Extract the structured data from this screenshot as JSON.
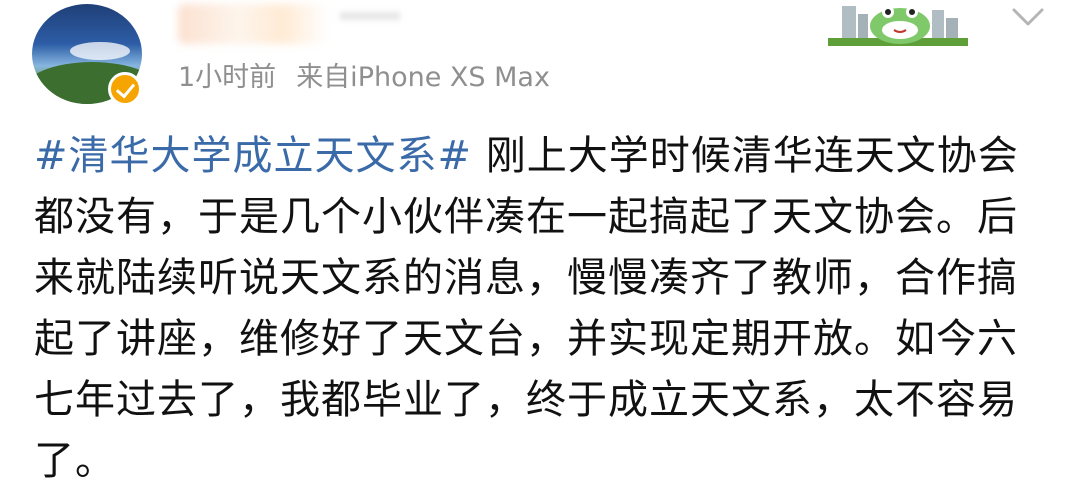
{
  "post": {
    "time": "1小时前",
    "source": "来自iPhone XS Max",
    "topic": "#清华大学成立天文系#",
    "body": " 刚上大学时候清华连天文协会都没有，于是几个小伙伴凑在一起搞起了天文协会。后来就陆续听说天文系的消息，慢慢凑齐了教师，合作搞起了讲座，维修好了天文台，并实现定期开放。如今六七年过去了，我都毕业了，终于成立天文系，太不容易了。"
  },
  "icons": {
    "avatar": "landscape-avatar",
    "badge": "verified-badge-icon",
    "sticker": "frog-sticker-icon",
    "menu": "chevron-down-icon"
  },
  "colors": {
    "topic": "#3a6aa8",
    "meta": "#8f8f8f",
    "badge": "#f5a400",
    "text": "#111111"
  }
}
